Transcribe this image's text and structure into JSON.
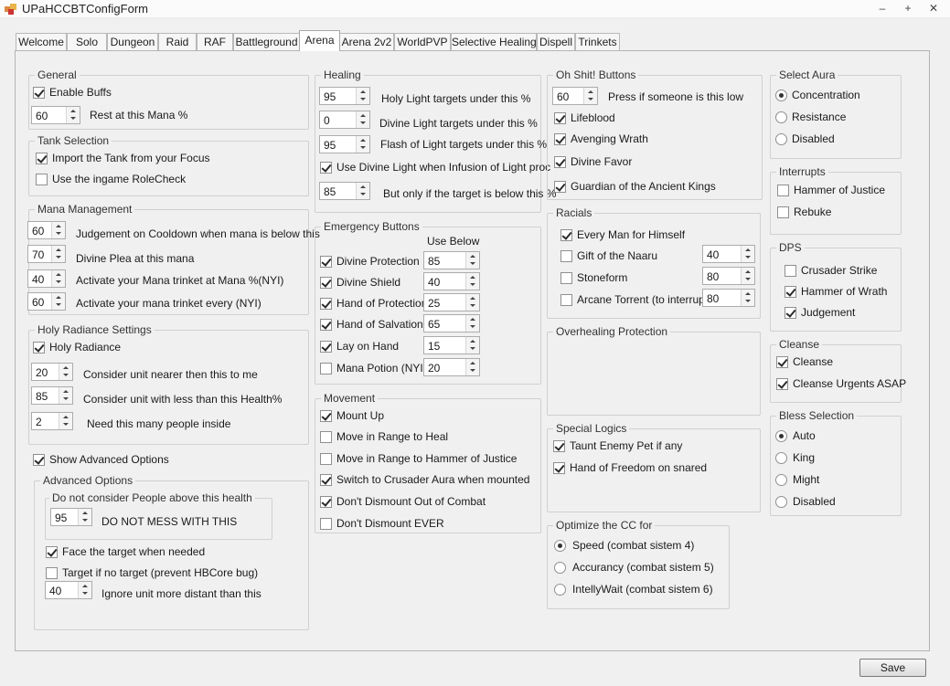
{
  "window": {
    "title": "UPaHCCBTConfigForm",
    "minimize": "–",
    "maximize": "+",
    "close": "✕"
  },
  "tabs": [
    "Welcome",
    "Solo",
    "Dungeon",
    "Raid",
    "RAF",
    "Battleground",
    "Arena",
    "Arena 2v2",
    "WorldPVP",
    "Selective Healing",
    "Dispell",
    "Trinkets"
  ],
  "active_tab": "Arena",
  "general": {
    "legend": "General",
    "enable_buffs": "Enable Buffs",
    "rest_value": "60",
    "rest_label": "Rest at this Mana %"
  },
  "tank": {
    "legend": "Tank Selection",
    "import_focus": "Import the Tank from your Focus",
    "rolecheck": "Use the ingame RoleCheck"
  },
  "mana": {
    "legend": "Mana Management",
    "rows": [
      {
        "value": "60",
        "label": "Judgement on Cooldown when mana is below this"
      },
      {
        "value": "70",
        "label": "Divine Plea at this mana"
      },
      {
        "value": "40",
        "label": "Activate your Mana trinket at Mana %(NYI)"
      },
      {
        "value": "60",
        "label": "Activate your mana trinket every (NYI)"
      }
    ]
  },
  "holy": {
    "legend": "Holy Radiance Settings",
    "enable": "Holy Radiance",
    "rows": [
      {
        "value": "20",
        "label": "Consider unit nearer then this to me"
      },
      {
        "value": "85",
        "label": "Consider unit with less than this Health%"
      },
      {
        "value": "2",
        "label": "Need this many people inside"
      }
    ]
  },
  "show_advanced": "Show Advanced Options",
  "advanced": {
    "legend": "Advanced Options",
    "inner_legend": "Do not consider People above this health",
    "health_value": "95",
    "health_label": "DO NOT MESS WITH THIS",
    "face": "Face the target when needed",
    "target_if": "Target if no target (prevent HBCore bug)",
    "distance_value": "40",
    "distance_label": "Ignore unit more distant than this"
  },
  "healing": {
    "legend": "Healing",
    "rows": [
      {
        "value": "95",
        "label": "Holy Light targets under this %"
      },
      {
        "value": "0",
        "label": "Divine Light targets under this %"
      },
      {
        "value": "95",
        "label": "Flash of Light targets under this %"
      }
    ],
    "use_divine": "Use Divine Light when Infusion of Light proc",
    "only_value": "85",
    "only_label": "But only if the target is below this %"
  },
  "emergency": {
    "legend": "Emergency Buttons",
    "use_below": "Use Below",
    "rows": [
      {
        "label": "Divine Protection",
        "value": "85",
        "checked": true
      },
      {
        "label": "Divine Shield",
        "value": "40",
        "checked": true
      },
      {
        "label": "Hand of Protection",
        "value": "25",
        "checked": true
      },
      {
        "label": "Hand of Salvation",
        "value": "65",
        "checked": true
      },
      {
        "label": "Lay on Hand",
        "value": "15",
        "checked": true
      },
      {
        "label": "Mana Potion (NYI)",
        "value": "20",
        "checked": false
      }
    ]
  },
  "movement": {
    "legend": "Movement",
    "rows": [
      {
        "label": "Mount Up",
        "checked": true
      },
      {
        "label": "Move in Range to Heal",
        "checked": false
      },
      {
        "label": "Move in Range to Hammer of Justice",
        "checked": false
      },
      {
        "label": "Switch to Crusader Aura when mounted",
        "checked": true
      },
      {
        "label": "Don't Dismount Out of Combat",
        "checked": true
      },
      {
        "label": "Don't Dismount EVER",
        "checked": false
      }
    ]
  },
  "ohshit": {
    "legend": "Oh Shit! Buttons",
    "value": "60",
    "label": "Press if someone is this low",
    "rows": [
      {
        "label": "Lifeblood",
        "checked": true
      },
      {
        "label": "Avenging Wrath",
        "checked": true
      },
      {
        "label": "Divine Favor",
        "checked": true
      },
      {
        "label": "Guardian of the Ancient Kings",
        "checked": true
      }
    ]
  },
  "racials": {
    "legend": "Racials",
    "rows": [
      {
        "label": "Every Man for Himself",
        "checked": true,
        "value": ""
      },
      {
        "label": "Gift of the Naaru",
        "checked": false,
        "value": "40"
      },
      {
        "label": "Stoneform",
        "checked": false,
        "value": "80"
      },
      {
        "label": "Arcane Torrent (to interrupt)",
        "checked": false,
        "value": "80"
      }
    ]
  },
  "overheal": {
    "legend": "Overhealing Protection"
  },
  "special": {
    "legend": "Special Logics",
    "taunt": "Taunt Enemy Pet if any",
    "freedom": "Hand of Freedom on snared"
  },
  "optimize": {
    "legend": "Optimize the CC for",
    "options": [
      "Speed (combat sistem 4)",
      "Accurancy (combat sistem 5)",
      "IntellyWait (combat sistem 6)"
    ],
    "selected": 0
  },
  "aura": {
    "legend": "Select Aura",
    "options": [
      "Concentration",
      "Resistance",
      "Disabled"
    ],
    "selected": 0
  },
  "interrupts": {
    "legend": "Interrupts",
    "rows": [
      {
        "label": "Hammer of Justice",
        "checked": false
      },
      {
        "label": "Rebuke",
        "checked": false
      }
    ]
  },
  "dps": {
    "legend": "DPS",
    "rows": [
      {
        "label": "Crusader Strike",
        "checked": false
      },
      {
        "label": "Hammer of Wrath",
        "checked": true
      },
      {
        "label": "Judgement",
        "checked": true
      }
    ]
  },
  "cleanse": {
    "legend": "Cleanse",
    "rows": [
      {
        "label": "Cleanse",
        "checked": true
      },
      {
        "label": "Cleanse Urgents ASAP",
        "checked": true
      }
    ]
  },
  "bless": {
    "legend": "Bless Selection",
    "options": [
      "Auto",
      "King",
      "Might",
      "Disabled"
    ],
    "selected": 0
  },
  "save": "Save"
}
